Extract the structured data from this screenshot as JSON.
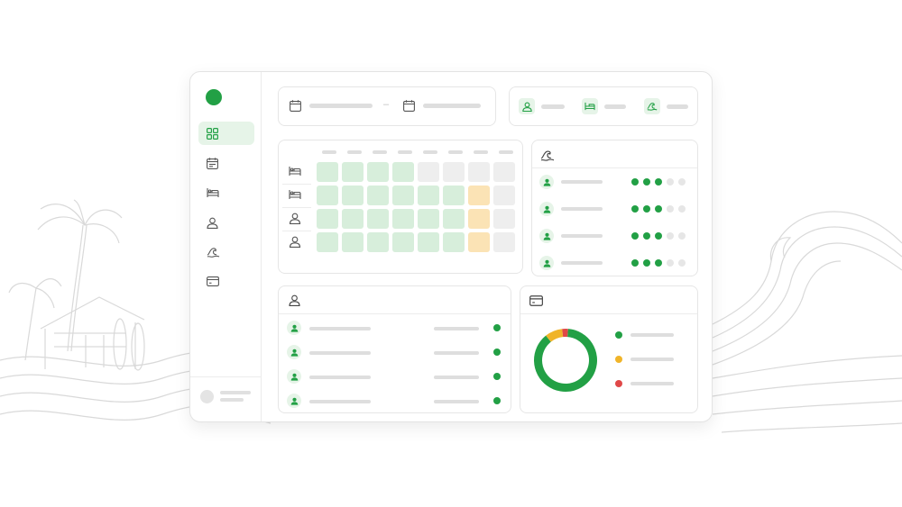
{
  "colors": {
    "brand": "#22a045",
    "accent_light": "#e6f4e8",
    "cell_booked": "#d7eedb",
    "cell_free": "#eeeeee",
    "cell_pending": "#fbe3b5",
    "status_yellow": "#f0b429",
    "status_red": "#e04848",
    "status_off": "#e6e6e6",
    "placeholder": "#dedede",
    "line_art": "#d9d9d9"
  },
  "sidebar": {
    "logo": "brand-logo-dot",
    "nav_items": [
      {
        "icon": "grid-icon",
        "active": true
      },
      {
        "icon": "calendar-icon",
        "active": false
      },
      {
        "icon": "bed-icon",
        "active": false
      },
      {
        "icon": "user-icon",
        "active": false
      },
      {
        "icon": "wave-icon",
        "active": false
      },
      {
        "icon": "credit-card-icon",
        "active": false
      }
    ],
    "footer": {
      "icon": "avatar"
    }
  },
  "date_range": {
    "start_icon": "calendar-icon",
    "end_icon": "calendar-icon",
    "separator": "–"
  },
  "filters": {
    "items": [
      {
        "icon": "user-icon"
      },
      {
        "icon": "bed-icon"
      },
      {
        "icon": "wave-icon"
      }
    ]
  },
  "calendar": {
    "row_icons": [
      "bed-icon",
      "bed-icon",
      "user-icon",
      "user-icon"
    ],
    "column_count": 8,
    "cells": [
      [
        "booked",
        "booked",
        "booked",
        "booked",
        "free",
        "free",
        "free",
        "free"
      ],
      [
        "booked",
        "booked",
        "booked",
        "booked",
        "booked",
        "booked",
        "pending",
        "free"
      ],
      [
        "booked",
        "booked",
        "booked",
        "booked",
        "booked",
        "booked",
        "pending",
        "free"
      ],
      [
        "booked",
        "booked",
        "booked",
        "booked",
        "booked",
        "booked",
        "pending",
        "free"
      ]
    ]
  },
  "surf_levels": {
    "header_icon": "wave-icon",
    "rows": [
      {
        "level": 3,
        "max": 5
      },
      {
        "level": 3,
        "max": 5
      },
      {
        "level": 3,
        "max": 5
      },
      {
        "level": 3,
        "max": 5
      }
    ]
  },
  "guests": {
    "header_icon": "user-icon",
    "rows": [
      {
        "status": "green"
      },
      {
        "status": "green"
      },
      {
        "status": "green"
      },
      {
        "status": "green"
      }
    ]
  },
  "payments": {
    "header_icon": "credit-card-icon",
    "legend": [
      {
        "color": "green"
      },
      {
        "color": "yellow"
      },
      {
        "color": "red"
      }
    ]
  },
  "chart_data": {
    "type": "pie",
    "donut": true,
    "slices": [
      {
        "color": "#22a045",
        "value": 0.88
      },
      {
        "color": "#f0b429",
        "value": 0.09
      },
      {
        "color": "#e04848",
        "value": 0.03
      }
    ]
  }
}
